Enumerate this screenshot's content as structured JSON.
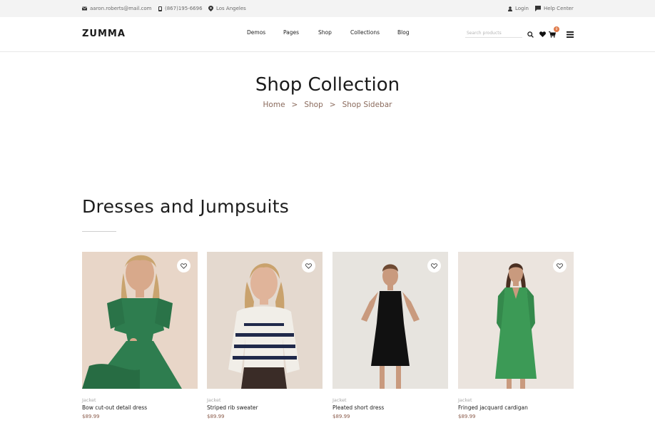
{
  "topbar": {
    "email": "aaron.roberts@mail.com",
    "phone": "(867)195-6696",
    "location": "Los Angeles",
    "login": "Login",
    "help": "Help Center"
  },
  "header": {
    "logo": "ZUMMA",
    "nav": [
      "Demos",
      "Pages",
      "Shop",
      "Collections",
      "Blog"
    ],
    "search_placeholder": "Search products",
    "cart_count": "0"
  },
  "hero": {
    "title": "Shop Collection",
    "breadcrumb": [
      "Home",
      "Shop",
      "Shop Sidebar"
    ],
    "breadcrumb_sep": ">"
  },
  "section": {
    "title": "Dresses and Jumpsuits"
  },
  "products": [
    {
      "category": "Jacket",
      "name": "Bow cut-out detail dress",
      "price": "$89.99"
    },
    {
      "category": "Jacket",
      "name": "Striped rib sweater",
      "price": "$89.99"
    },
    {
      "category": "Jacket",
      "name": "Pleated short dress",
      "price": "$89.99"
    },
    {
      "category": "Jacket",
      "name": "Fringed jacquard cardigan",
      "price": "$89.99"
    }
  ],
  "colors": {
    "accent": "#e07b4b",
    "breadcrumb": "#8a6a5c",
    "price": "#8a5a4a"
  }
}
